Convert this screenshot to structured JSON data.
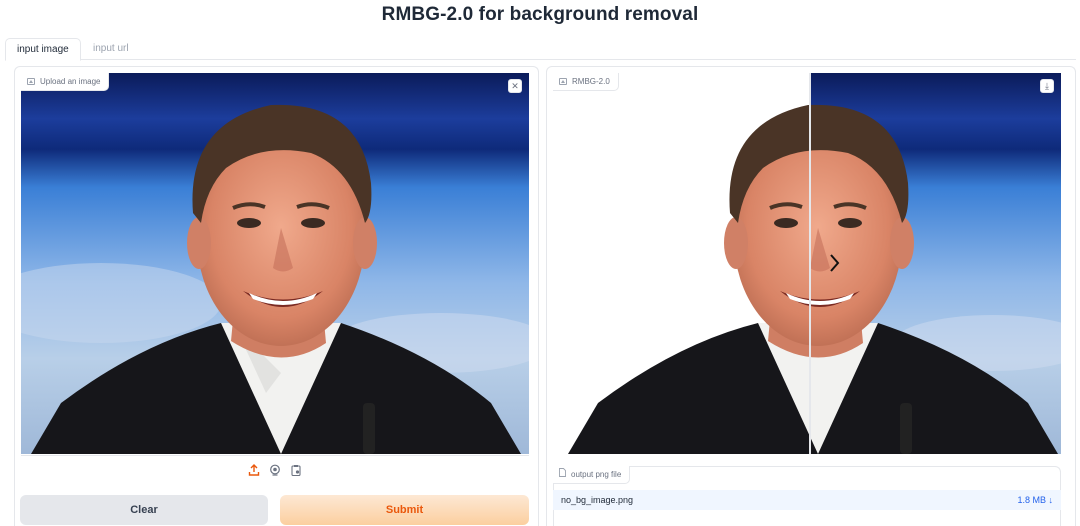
{
  "app": {
    "title": "RMBG-2.0 for background removal"
  },
  "tabs": [
    {
      "label": "input image",
      "active": true
    },
    {
      "label": "input url",
      "active": false
    }
  ],
  "input_panel": {
    "label": "Upload an image",
    "close_icon": "close-icon",
    "tools": [
      "upload-icon",
      "webcam-icon",
      "clipboard-icon"
    ]
  },
  "output_panel": {
    "label": "RMBG-2.0",
    "download_icon": "download-icon",
    "slider_handle_icon": "chevron-right-icon"
  },
  "file_output": {
    "label": "output png file",
    "file_name": "no_bg_image.png",
    "file_size": "1.8 MB",
    "download_glyph": "↓"
  },
  "buttons": {
    "clear_label": "Clear",
    "submit_label": "Submit"
  },
  "colors": {
    "accent": "#ea580c",
    "submit_gradient_start": "#fde8d4",
    "submit_gradient_end": "#fbcf9f",
    "link": "#2563eb"
  }
}
